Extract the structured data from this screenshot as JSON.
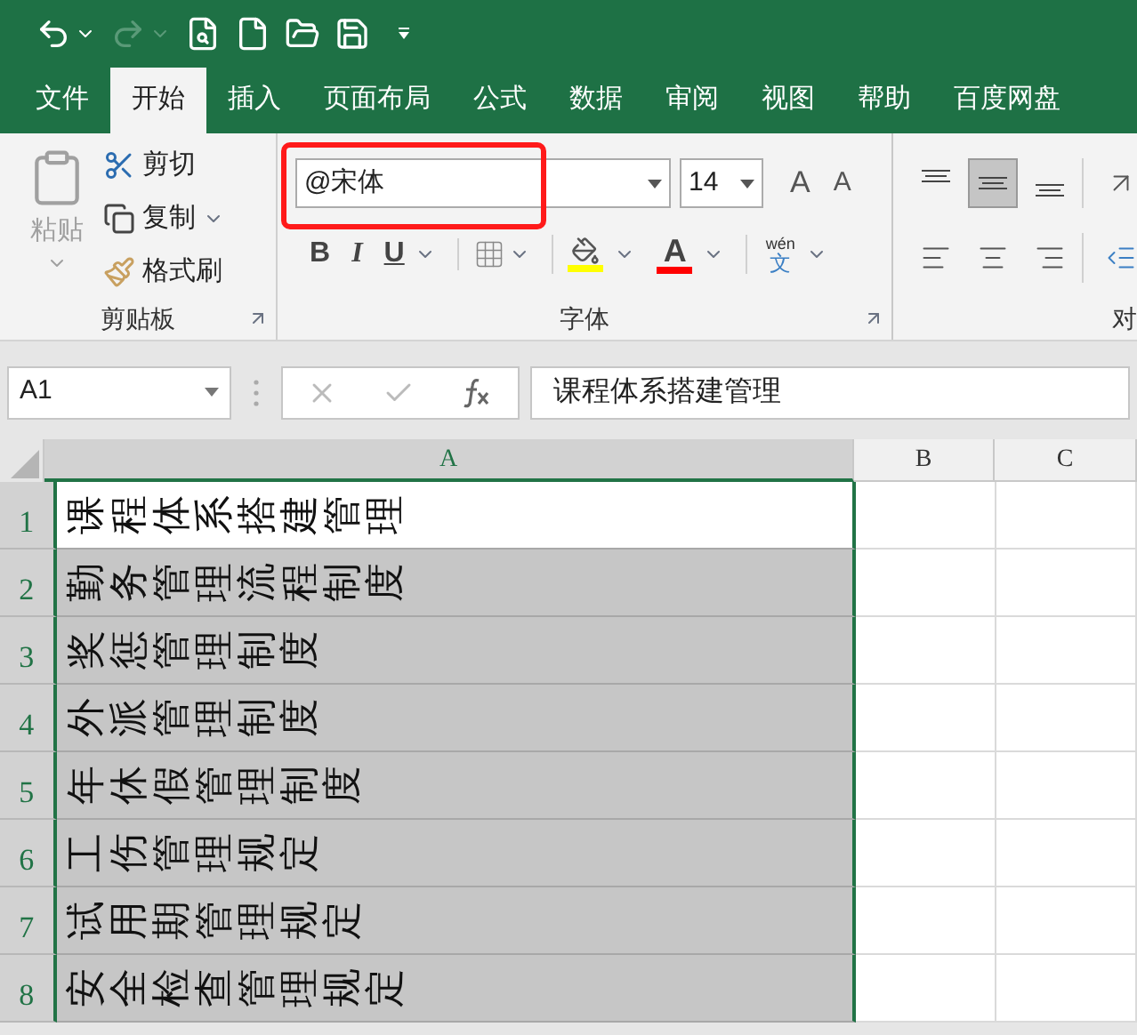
{
  "quick_access": [
    {
      "kind": "undo",
      "disabled": false
    },
    {
      "kind": "redo",
      "disabled": true
    },
    {
      "kind": "preview",
      "disabled": false
    },
    {
      "kind": "new",
      "disabled": false
    },
    {
      "kind": "open",
      "disabled": false
    },
    {
      "kind": "save",
      "disabled": false
    },
    {
      "kind": "customize",
      "disabled": false
    }
  ],
  "tabs": [
    {
      "label": "文件",
      "selected": false
    },
    {
      "label": "开始",
      "selected": true
    },
    {
      "label": "插入",
      "selected": false
    },
    {
      "label": "页面布局",
      "selected": false
    },
    {
      "label": "公式",
      "selected": false
    },
    {
      "label": "数据",
      "selected": false
    },
    {
      "label": "审阅",
      "selected": false
    },
    {
      "label": "视图",
      "selected": false
    },
    {
      "label": "帮助",
      "selected": false
    },
    {
      "label": "百度网盘",
      "selected": false
    }
  ],
  "clipboard": {
    "paste": {
      "label": "粘贴",
      "disabled": true
    },
    "items": [
      {
        "kind": "cut",
        "label": "剪切",
        "dropdown": false
      },
      {
        "kind": "copy",
        "label": "复制",
        "dropdown": true
      },
      {
        "kind": "format_painter",
        "label": "格式刷",
        "dropdown": false
      }
    ],
    "group_label": "剪贴板"
  },
  "font": {
    "font_name": {
      "value": "@宋体",
      "highlighted": true
    },
    "font_size": "14",
    "grow": "A",
    "shrink": "A",
    "bold": "B",
    "italic": "I",
    "underline": "U",
    "font_color_letter": "A",
    "fill": {
      "color": "#ffff00"
    },
    "font_color": {
      "color": "#ff0000"
    },
    "phonetic": {
      "top": "wén",
      "bottom": "文"
    },
    "group_label": "字体"
  },
  "alignment": {
    "group_label": "对",
    "items": [
      {
        "kind": "top",
        "selected": false
      },
      {
        "kind": "middle",
        "selected": true
      },
      {
        "kind": "bottom",
        "selected": false
      },
      {
        "kind": "orientation",
        "selected": false
      },
      {
        "kind": "left",
        "selected": false
      },
      {
        "kind": "center",
        "selected": false
      },
      {
        "kind": "right",
        "selected": false
      },
      {
        "kind": "indent",
        "selected": false
      }
    ]
  },
  "formula_bar": {
    "name_box": "A1",
    "formula": "课程体系搭建管理"
  },
  "columns": [
    {
      "label": "A",
      "selected": true
    },
    {
      "label": "B",
      "selected": false
    },
    {
      "label": "C",
      "selected": false
    }
  ],
  "rows": [
    {
      "number": "1",
      "text": "课程体系搭建管理",
      "active": true
    },
    {
      "number": "2",
      "text": "勤务管理流程制度",
      "active": false
    },
    {
      "number": "3",
      "text": "奖惩管理制度",
      "active": false
    },
    {
      "number": "4",
      "text": "外派管理制度",
      "active": false
    },
    {
      "number": "5",
      "text": "年休假管理制度",
      "active": false
    },
    {
      "number": "6",
      "text": "工伤管理规定",
      "active": false
    },
    {
      "number": "7",
      "text": "试用期管理规定",
      "active": false
    },
    {
      "number": "8",
      "text": "安全检查管理规定",
      "active": false
    }
  ]
}
